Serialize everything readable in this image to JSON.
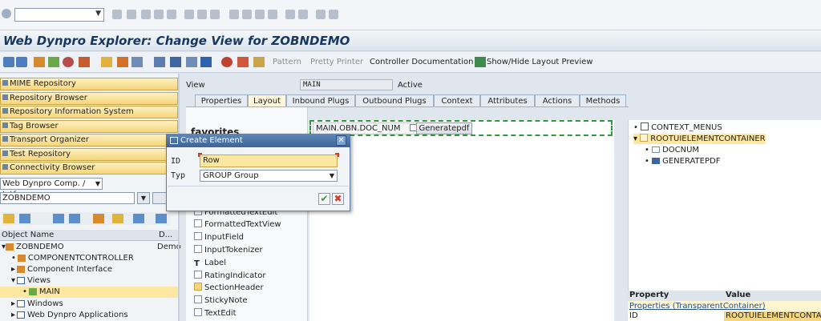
{
  "window": {
    "title": "Web Dynpro Explorer: Change View for ZOBNDEMO"
  },
  "toolbar": {
    "pattern": "Pattern",
    "pretty_printer": "Pretty Printer",
    "controller_documentation": "Controller Documentation",
    "layout_preview": "Show/Hide Layout Preview"
  },
  "left": {
    "buttons": [
      "MIME Repository",
      "Repository Browser",
      "Repository Information System",
      "Tag Browser",
      "Transport Organizer",
      "Test Repository",
      "Connectivity Browser"
    ],
    "object_type": "Web Dynpro Comp. / Intf.",
    "object_name_value": "ZOBNDEMO",
    "tree_header": {
      "name": "Object Name",
      "desc": "D..."
    },
    "tree": [
      {
        "label": "ZOBNDEMO",
        "desc": "Demo"
      },
      {
        "label": "COMPONENTCONTROLLER",
        "desc": ""
      },
      {
        "label": "Component Interface",
        "desc": ""
      },
      {
        "label": "Views",
        "desc": ""
      },
      {
        "label": "MAIN",
        "desc": ""
      },
      {
        "label": "Windows",
        "desc": ""
      },
      {
        "label": "Web Dynpro Applications",
        "desc": ""
      }
    ]
  },
  "view": {
    "label": "View",
    "name": "MAIN",
    "status": "Active"
  },
  "tabs": [
    "Properties",
    "Layout",
    "Inbound Plugs",
    "Outbound Plugs",
    "Context",
    "Attributes",
    "Actions",
    "Methods"
  ],
  "palette": {
    "title": "favorites",
    "items": [
      "FormattedTextEdit",
      "FormattedTextView",
      "InputField",
      "InputTokenizer",
      "Label",
      "RatingIndicator",
      "SectionHeader",
      "StickyNote",
      "TextEdit"
    ]
  },
  "canvas": {
    "label_text": "MAIN.OBN.DOC_NUM",
    "button_text": "Generatepdf"
  },
  "element_tree": [
    "CONTEXT_MENUS",
    "ROOTUIELEMENTCONTAINER",
    "DOCNUM",
    "GENERATEPDF"
  ],
  "properties": {
    "headers": {
      "property": "Property",
      "value": "Value"
    },
    "group": "Properties (TransparentContainer)",
    "row_property": "ID",
    "row_value": "ROOTUIELEMENTCONTAINER"
  },
  "dialog": {
    "title": "Create Element",
    "id_label": "ID",
    "id_value": "Row",
    "typ_label": "Typ",
    "typ_value": "GROUP Group"
  }
}
